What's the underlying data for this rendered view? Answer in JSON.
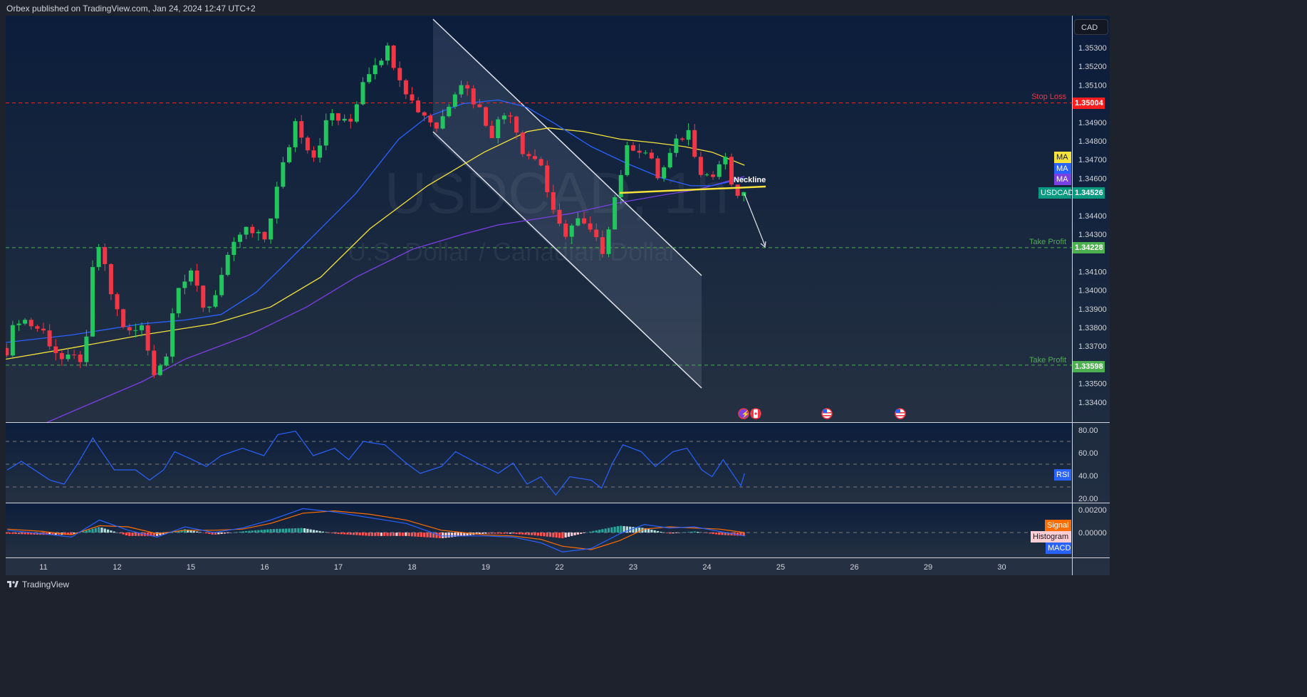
{
  "header": {
    "published": "Orbex published on TradingView.com, Jan 24, 2024 12:47 UTC+2"
  },
  "footer": {
    "brand": "TradingView"
  },
  "watermark": {
    "symbol_interval": "USDCAD, 1h",
    "description": "U.S. Dollar / Canadian Dollar"
  },
  "currency_button": "CAD",
  "colors": {
    "up": "#22c55e",
    "down": "#f23645",
    "ma_yellow": "#f5e33b",
    "ma_blue": "#2962ff",
    "ma_purple": "#7b3fe4",
    "stop": "#ff1e1e",
    "tp": "#4caf50",
    "last": "#089981",
    "rsi": "#2962ff",
    "signal": "#ff6d00",
    "macd": "#2962ff"
  },
  "levels": {
    "stop_loss": {
      "label": "Stop Loss",
      "price": 1.35004,
      "price_text": "1.35004"
    },
    "take_profit_1": {
      "label": "Take Profit",
      "price": 1.34228,
      "price_text": "1.34228"
    },
    "take_profit_2": {
      "label": "Take Profit",
      "price": 1.33598,
      "price_text": "1.33598"
    }
  },
  "last_price": {
    "symbol": "USDCAD",
    "price_text": "1.34526"
  },
  "ma_tags": [
    "MA",
    "MA",
    "MA"
  ],
  "annotations": {
    "neckline": "Neckline"
  },
  "indicator_tags": {
    "rsi": "RSI",
    "signal": "Signal",
    "histogram": "Histogram",
    "macd": "MACD"
  },
  "chart_data": {
    "type": "line",
    "title": "USDCAD, 1h",
    "subtitle": "U.S. Dollar / Canadian Dollar",
    "x_unit": "trading days since Jan 11 00:00",
    "x_ticks": [
      {
        "t": 0,
        "label": "11"
      },
      {
        "t": 1,
        "label": "12"
      },
      {
        "t": 2,
        "label": "15"
      },
      {
        "t": 3,
        "label": "16"
      },
      {
        "t": 4,
        "label": "17"
      },
      {
        "t": 5,
        "label": "18"
      },
      {
        "t": 6,
        "label": "19"
      },
      {
        "t": 7,
        "label": "22"
      },
      {
        "t": 8,
        "label": "23"
      },
      {
        "t": 9,
        "label": "24"
      },
      {
        "t": 10,
        "label": "25"
      },
      {
        "t": 11,
        "label": "26"
      },
      {
        "t": 12,
        "label": "29"
      },
      {
        "t": 13,
        "label": "30"
      }
    ],
    "y_ticks": [
      "1.35300",
      "1.35200",
      "1.35100",
      "1.34900",
      "1.34800",
      "1.34700",
      "1.34600",
      "1.34400",
      "1.34300",
      "1.34100",
      "1.34000",
      "1.33900",
      "1.33800",
      "1.33700",
      "1.33500",
      "1.33400"
    ],
    "price_path": [
      [
        -0.49,
        1.3369
      ],
      [
        -0.35,
        1.3386
      ],
      [
        -0.01,
        1.3378
      ],
      [
        0.28,
        1.3361
      ],
      [
        0.57,
        1.3365
      ],
      [
        0.71,
        1.343
      ],
      [
        0.81,
        1.3414
      ],
      [
        0.96,
        1.3392
      ],
      [
        1.15,
        1.3376
      ],
      [
        1.34,
        1.338
      ],
      [
        1.49,
        1.3357
      ],
      [
        1.68,
        1.3365
      ],
      [
        1.78,
        1.3403
      ],
      [
        2.02,
        1.3407
      ],
      [
        2.21,
        1.3388
      ],
      [
        2.41,
        1.3407
      ],
      [
        2.7,
        1.3433
      ],
      [
        2.99,
        1.3426
      ],
      [
        3.18,
        1.3456
      ],
      [
        3.42,
        1.3491
      ],
      [
        3.66,
        1.3472
      ],
      [
        3.9,
        1.3495
      ],
      [
        4.14,
        1.3487
      ],
      [
        4.34,
        1.3514
      ],
      [
        4.53,
        1.3525
      ],
      [
        4.68,
        1.3529
      ],
      [
        4.82,
        1.3517
      ],
      [
        5.01,
        1.35
      ],
      [
        5.21,
        1.3493
      ],
      [
        5.35,
        1.3487
      ],
      [
        5.64,
        1.3514
      ],
      [
        5.84,
        1.3502
      ],
      [
        6.08,
        1.3485
      ],
      [
        6.32,
        1.3498
      ],
      [
        6.51,
        1.3475
      ],
      [
        6.75,
        1.3468
      ],
      [
        6.9,
        1.3441
      ],
      [
        7.04,
        1.343
      ],
      [
        7.24,
        1.3437
      ],
      [
        7.43,
        1.343
      ],
      [
        7.57,
        1.342
      ],
      [
        7.72,
        1.3445
      ],
      [
        7.86,
        1.3468
      ],
      [
        7.96,
        1.3479
      ],
      [
        8.15,
        1.3475
      ],
      [
        8.35,
        1.346
      ],
      [
        8.54,
        1.3475
      ],
      [
        8.73,
        1.3487
      ],
      [
        8.93,
        1.3464
      ],
      [
        9.07,
        1.346
      ],
      [
        9.22,
        1.3472
      ],
      [
        9.36,
        1.3454
      ],
      [
        9.46,
        1.3441
      ],
      [
        9.51,
        1.34526
      ]
    ],
    "ma_yellow": [
      [
        -0.51,
        1.3363
      ],
      [
        0.38,
        1.3369
      ],
      [
        1.34,
        1.3376
      ],
      [
        2.31,
        1.3382
      ],
      [
        3.08,
        1.3391
      ],
      [
        3.76,
        1.3407
      ],
      [
        4.43,
        1.3433
      ],
      [
        5.21,
        1.3456
      ],
      [
        5.98,
        1.3474
      ],
      [
        6.56,
        1.3485
      ],
      [
        6.85,
        1.3487
      ],
      [
        7.33,
        1.3485
      ],
      [
        7.82,
        1.3481
      ],
      [
        8.3,
        1.3479
      ],
      [
        8.69,
        1.3477
      ],
      [
        9.07,
        1.3474
      ],
      [
        9.51,
        1.3467
      ]
    ],
    "ma_blue": [
      [
        -0.51,
        1.3372
      ],
      [
        0.38,
        1.3376
      ],
      [
        1.34,
        1.3382
      ],
      [
        1.92,
        1.3384
      ],
      [
        2.41,
        1.3387
      ],
      [
        2.89,
        1.3399
      ],
      [
        3.28,
        1.3414
      ],
      [
        3.76,
        1.3433
      ],
      [
        4.24,
        1.3452
      ],
      [
        4.82,
        1.3481
      ],
      [
        5.21,
        1.3493
      ],
      [
        5.69,
        1.35
      ],
      [
        6.17,
        1.3502
      ],
      [
        6.56,
        1.3498
      ],
      [
        6.95,
        1.3489
      ],
      [
        7.43,
        1.3477
      ],
      [
        7.91,
        1.3468
      ],
      [
        8.4,
        1.346
      ],
      [
        8.78,
        1.3456
      ],
      [
        9.07,
        1.3456
      ],
      [
        9.51,
        1.346
      ]
    ],
    "ma_purple": [
      [
        0.04,
        1.3329
      ],
      [
        0.57,
        1.3338
      ],
      [
        1.34,
        1.3351
      ],
      [
        1.92,
        1.3363
      ],
      [
        2.79,
        1.3376
      ],
      [
        3.57,
        1.3391
      ],
      [
        4.24,
        1.3407
      ],
      [
        5.01,
        1.3422
      ],
      [
        5.69,
        1.343
      ],
      [
        6.17,
        1.3435
      ],
      [
        7.14,
        1.3441
      ],
      [
        7.82,
        1.3447
      ],
      [
        8.4,
        1.3451
      ],
      [
        8.88,
        1.3454
      ],
      [
        9.51,
        1.3461
      ]
    ],
    "rsi": {
      "ticks": [
        "80.00",
        "60.00",
        "40.00",
        "20.00"
      ],
      "levels": [
        70,
        50,
        30
      ],
      "path": [
        [
          -0.49,
          45
        ],
        [
          -0.3,
          52.5
        ],
        [
          0.09,
          36
        ],
        [
          0.28,
          32.5
        ],
        [
          0.47,
          51
        ],
        [
          0.67,
          73
        ],
        [
          0.76,
          64
        ],
        [
          0.96,
          45
        ],
        [
          1.25,
          45
        ],
        [
          1.44,
          36
        ],
        [
          1.63,
          45
        ],
        [
          1.78,
          61
        ],
        [
          2.02,
          54
        ],
        [
          2.21,
          48
        ],
        [
          2.41,
          57.5
        ],
        [
          2.7,
          64
        ],
        [
          2.99,
          57.5
        ],
        [
          3.18,
          76
        ],
        [
          3.42,
          79
        ],
        [
          3.66,
          57.5
        ],
        [
          3.95,
          64
        ],
        [
          4.14,
          54
        ],
        [
          4.34,
          70
        ],
        [
          4.63,
          67
        ],
        [
          4.92,
          51
        ],
        [
          5.11,
          42
        ],
        [
          5.4,
          48
        ],
        [
          5.59,
          61
        ],
        [
          5.88,
          51
        ],
        [
          6.17,
          42
        ],
        [
          6.37,
          51
        ],
        [
          6.56,
          32.5
        ],
        [
          6.75,
          39
        ],
        [
          6.95,
          23
        ],
        [
          7.14,
          39
        ],
        [
          7.43,
          36
        ],
        [
          7.57,
          29
        ],
        [
          7.72,
          51
        ],
        [
          7.86,
          67
        ],
        [
          8.11,
          61
        ],
        [
          8.3,
          48
        ],
        [
          8.54,
          61
        ],
        [
          8.73,
          64
        ],
        [
          8.93,
          45
        ],
        [
          9.07,
          39
        ],
        [
          9.22,
          54
        ],
        [
          9.46,
          31
        ],
        [
          9.51,
          42
        ]
      ]
    },
    "macd": {
      "ticks": [
        "0.00200",
        "0.00000"
      ],
      "macd_path": [
        [
          -0.49,
          0.0002
        ],
        [
          -0.01,
          -0.0001
        ],
        [
          0.38,
          -0.0004
        ],
        [
          0.76,
          0.0011
        ],
        [
          1.15,
          0.0002
        ],
        [
          1.54,
          -0.0004
        ],
        [
          1.92,
          0.0005
        ],
        [
          2.31,
          0.0
        ],
        [
          2.7,
          0.0004
        ],
        [
          3.08,
          0.0011
        ],
        [
          3.52,
          0.0021
        ],
        [
          3.95,
          0.0018
        ],
        [
          4.43,
          0.0013
        ],
        [
          4.92,
          0.0008
        ],
        [
          5.4,
          -0.0003
        ],
        [
          5.98,
          -0.0003
        ],
        [
          6.37,
          -0.0004
        ],
        [
          6.75,
          -0.0009
        ],
        [
          7.04,
          -0.0017
        ],
        [
          7.43,
          -0.0014
        ],
        [
          7.82,
          -0.0001
        ],
        [
          8.15,
          0.0007
        ],
        [
          8.49,
          0.0004
        ],
        [
          8.83,
          0.0005
        ],
        [
          9.17,
          0.0001
        ],
        [
          9.51,
          -0.0003
        ]
      ],
      "signal_path": [
        [
          -0.49,
          0.0003
        ],
        [
          -0.01,
          0.0001
        ],
        [
          0.38,
          -0.0002
        ],
        [
          0.76,
          0.0006
        ],
        [
          1.15,
          0.0005
        ],
        [
          1.54,
          -0.0001
        ],
        [
          1.92,
          0.0002
        ],
        [
          2.31,
          0.0002
        ],
        [
          2.7,
          0.0003
        ],
        [
          3.08,
          0.0008
        ],
        [
          3.52,
          0.0017
        ],
        [
          3.95,
          0.0019
        ],
        [
          4.43,
          0.0016
        ],
        [
          4.92,
          0.0011
        ],
        [
          5.4,
          0.0002
        ],
        [
          5.98,
          -0.0002
        ],
        [
          6.37,
          -0.0003
        ],
        [
          6.75,
          -0.0006
        ],
        [
          7.04,
          -0.0012
        ],
        [
          7.43,
          -0.0015
        ],
        [
          7.82,
          -0.0007
        ],
        [
          8.15,
          0.0003
        ],
        [
          8.49,
          0.0005
        ],
        [
          8.83,
          0.0004
        ],
        [
          9.17,
          0.0003
        ],
        [
          9.51,
          0.0
        ]
      ]
    }
  }
}
